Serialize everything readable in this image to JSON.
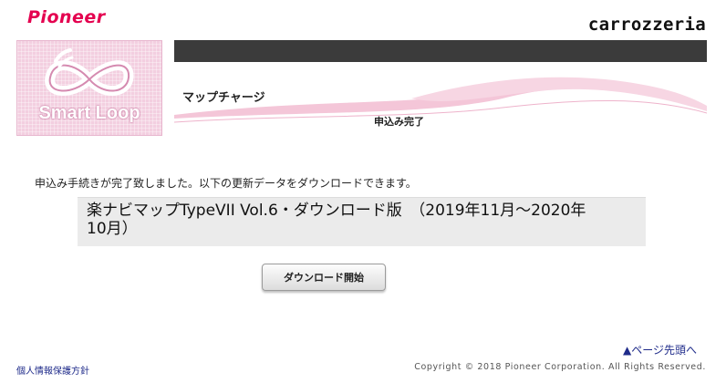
{
  "header": {
    "brand": "Pioneer",
    "sub_brand": "carrozzeria",
    "service_logo": "Smart Loop"
  },
  "page": {
    "section_title": "マップチャージ",
    "step_label": "申込み完了",
    "message": "申込み手続きが完了致しました。以下の更新データをダウンロードできます。"
  },
  "product": {
    "name": "楽ナビマップTypeVII Vol.6・ダウンロード版　（2019年11月～2020年10月）"
  },
  "actions": {
    "download_label": "ダウンロード開始"
  },
  "footer": {
    "page_top": "▲ページ先頭へ",
    "privacy": "個人情報保護方針",
    "copyright": "Copyright © 2018 Pioneer Corporation. All Rights Reserved."
  },
  "colors": {
    "brand_pink": "#e4004f",
    "header_bar": "#3b3b3b",
    "link_blue": "#1f2b8a",
    "logo_bg": "#f3cfe0"
  }
}
